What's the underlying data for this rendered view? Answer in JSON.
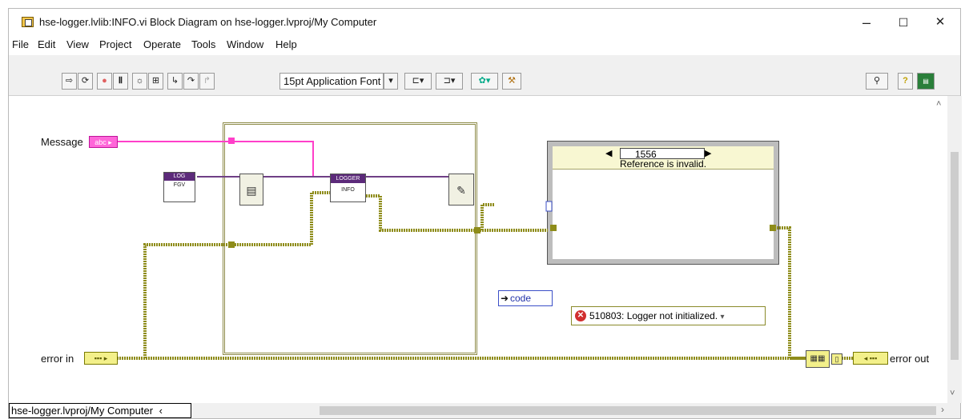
{
  "window": {
    "title": "hse-logger.lvlib:INFO.vi Block Diagram on hse-logger.lvproj/My Computer",
    "controls": {
      "minimize": "–",
      "maximize": "☐",
      "close": "✕"
    }
  },
  "menu": [
    "File",
    "Edit",
    "View",
    "Project",
    "Operate",
    "Tools",
    "Window",
    "Help"
  ],
  "toolbar": {
    "font_select": "15pt Application Font"
  },
  "diagram": {
    "message_label": "Message",
    "error_in_label": "error in",
    "error_out_label": "error out",
    "case_selector_value": "1556",
    "case_name": "Reference is invalid.",
    "error_constant": "510803: Logger not initialized.",
    "unbundle_field": "code",
    "subvi_log": "LOG",
    "subvi_logger": "LOGGER",
    "subvi_info": "INFO"
  },
  "statusbar": {
    "path": "hse-logger.lvproj/My Computer"
  },
  "colors": {
    "error_wire": "#8e8c1a",
    "string_wire": "#ff3fc9",
    "ref_wire": "#6f3f86"
  }
}
